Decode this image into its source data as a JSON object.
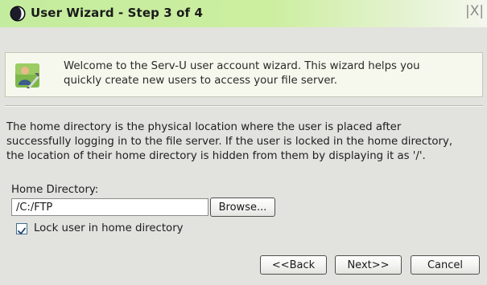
{
  "window": {
    "title": "User Wizard - Step 3 of 4",
    "close_glyph": "|X|",
    "icon": "serv-u-logo-icon"
  },
  "banner": {
    "icon": "user-wizard-icon",
    "line1": "Welcome to the Serv-U user account wizard. This wizard helps you",
    "line2": "quickly create new users to access your file server."
  },
  "description": {
    "line1": "The home directory is the physical location where the user is placed after",
    "line2": "successfully logging in to the file server. If the user is locked in the home directory,",
    "line3": "the location of their home directory is hidden from them by displaying it as '/'."
  },
  "home_directory": {
    "label": "Home Directory:",
    "value": "/C:/FTP",
    "browse_label": "Browse..."
  },
  "lock_option": {
    "label": "Lock user in home directory",
    "checked": true
  },
  "buttons": {
    "back_label": "<<Back",
    "next_label": "Next>>",
    "cancel_label": "Cancel"
  },
  "colors": {
    "title_bar": "#c4ec9e",
    "dialog_bg": "#e2e2df",
    "banner_bg": "#f6f8ed"
  }
}
